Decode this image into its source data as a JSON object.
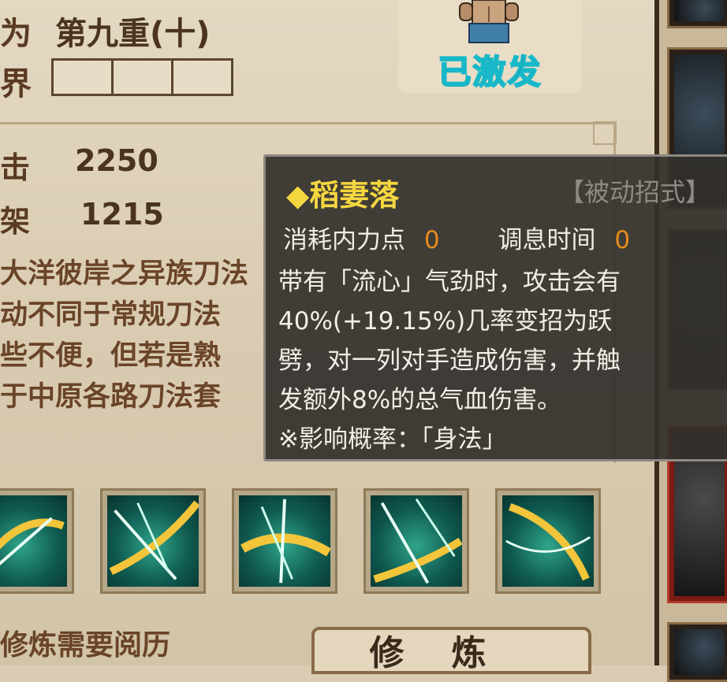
{
  "header": {
    "level_label": "为",
    "level_value": "第九重(十)",
    "realm_label": "界"
  },
  "portrait": {
    "status": "已激发"
  },
  "stats": [
    {
      "label": "击",
      "value": "2250"
    },
    {
      "label": "架",
      "value": "1215"
    }
  ],
  "description": {
    "lines": [
      "大洋彼岸之异族刀法",
      "动不同于常规刀法",
      "些不便，但若是熟",
      "于中原各路刀法套"
    ]
  },
  "tooltip": {
    "title": "◆稻妻落",
    "tag": "【被动招式】",
    "cost_label": "消耗内力点",
    "cost_value": "0",
    "cooldown_label": "调息时间",
    "cooldown_value": "0",
    "body_lines": [
      "带有「流心」气劲时，攻击会有",
      "40%(+19.15%)几率变招为跃",
      "劈，对一列对手造成伤害，并触",
      "发额外8%的总气血伤害。",
      "※影响概率：「身法」"
    ]
  },
  "skills": [
    "skill-1",
    "skill-2",
    "skill-3",
    "skill-4",
    "skill-5"
  ],
  "footer": {
    "requirement": "修炼需要阅历",
    "train_button": "修炼"
  },
  "colors": {
    "tooltip_title": "#f4d640",
    "tooltip_cost": "#e58b1e",
    "activated_text": "#0f2a54",
    "activated_outline": "#18b8c8"
  }
}
